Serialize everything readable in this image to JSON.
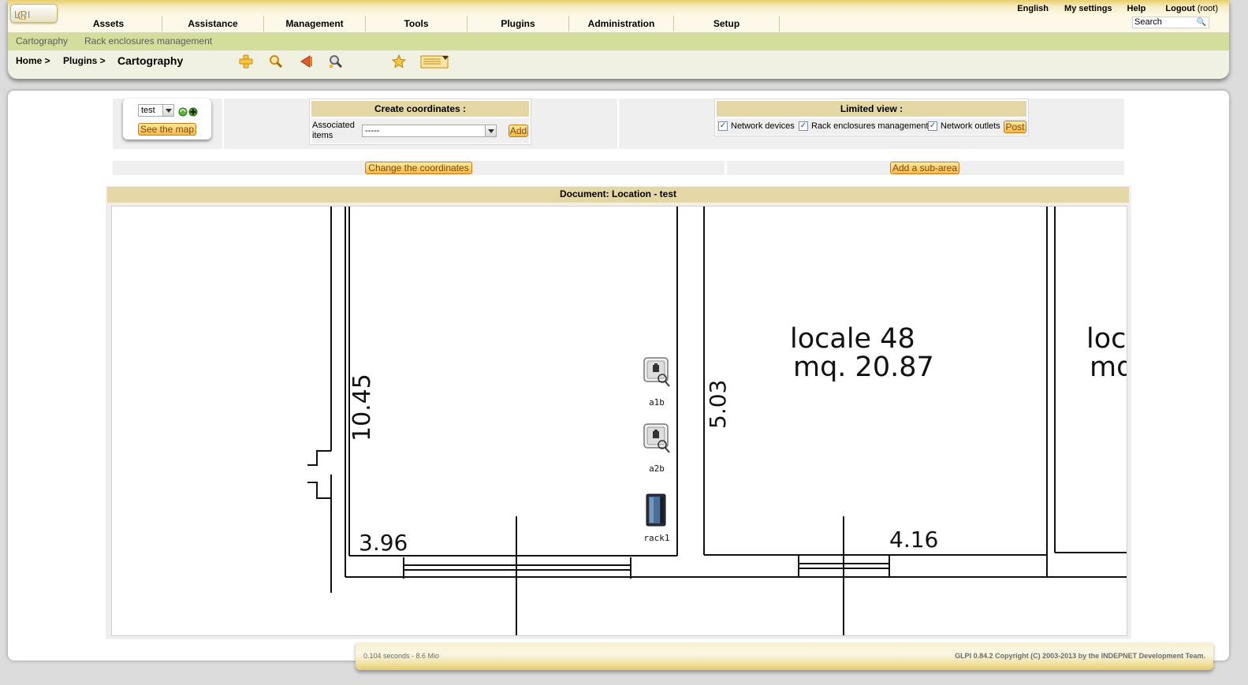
{
  "brand": {
    "logo_g": "G",
    "logo_lpi": "LPI"
  },
  "toplinks": {
    "language": "English",
    "settings": "My settings",
    "help": "Help",
    "logout": "Logout",
    "user": "(root)"
  },
  "menu": [
    "Assets",
    "Assistance",
    "Management",
    "Tools",
    "Plugins",
    "Administration",
    "Setup"
  ],
  "search": {
    "value": "Search"
  },
  "submenu": {
    "item1": "Cartography",
    "item2": "Rack enclosures management"
  },
  "breadcrumb": {
    "home": "Home >",
    "plugins": "Plugins >",
    "title": "Cartography"
  },
  "selector": {
    "value": "test",
    "button": "See the map"
  },
  "create": {
    "title": "Create coordinates :",
    "label_line1": "Associated",
    "label_line2": "items",
    "select_value": "-----",
    "add_button": "Add"
  },
  "limited": {
    "title": "Limited view :",
    "opt1": "Network devices",
    "opt2": "Rack enclosures management",
    "opt3": "Network outlets",
    "post_button": "Post"
  },
  "actions": {
    "change": "Change the coordinates",
    "subarea": "Add a sub-area"
  },
  "document": {
    "title": "Document: Location - test"
  },
  "plan": {
    "dim_left": "10.45",
    "dim_mid": "5.03",
    "dim_bottom_left": "3.96",
    "dim_bottom_right": "4.16",
    "room_line1": "locale  48",
    "room_line2": "mq.  20.87",
    "room2_line1": "loca",
    "room2_line2": "mq"
  },
  "items": [
    {
      "name": "a1b",
      "icon": "network-outlet-icon"
    },
    {
      "name": "a2b",
      "icon": "network-outlet-icon"
    },
    {
      "name": "rack1",
      "icon": "rack-icon"
    }
  ],
  "footer": {
    "timing": "0.104 seconds - 8.6 Mio",
    "copyright": "GLPI 0.84.2 Copyright (C) 2003-2013 by the INDEPNET Development Team."
  }
}
